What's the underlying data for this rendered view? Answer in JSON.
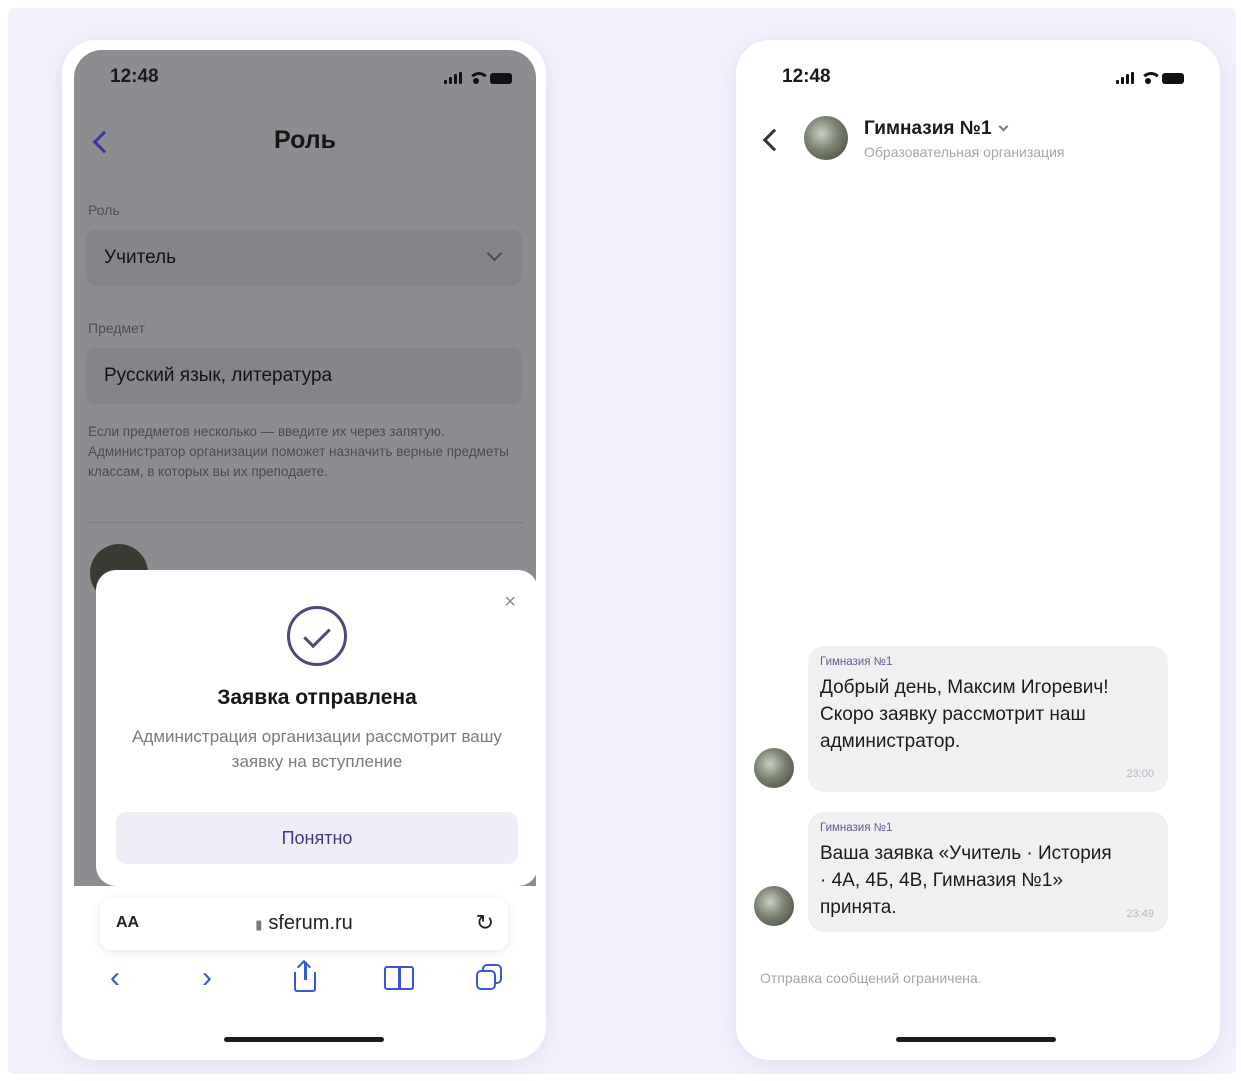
{
  "left_phone": {
    "status_time": "12:48",
    "screen_title": "Роль",
    "role_label": "Роль",
    "role_value": "Учитель",
    "subject_label": "Предмет",
    "subject_value": "Русский язык, литература",
    "hint": "Если предметов несколько — введите их через запятую. Администратор организации поможет назначить верные предметы классам, в которых вы их преподаете.",
    "modal": {
      "close": "×",
      "title": "Заявка отправлена",
      "text": "Администрация организации рассмотрит вашу заявку на вступление",
      "button": "Понятно"
    },
    "browser": {
      "text_size": "AA",
      "url": "sferum.ru",
      "reload": "↻",
      "back": "‹",
      "forward": "›"
    }
  },
  "right_phone": {
    "status_time": "12:48",
    "chat_name": "Гимназия №1",
    "chat_subtitle": "Образовательная организация",
    "messages": [
      {
        "sender": "Гимназия №1",
        "text": "Добрый день, Максим Игоревич! Скоро заявку рассмотрит наш администратор.",
        "time": "23:00"
      },
      {
        "sender": "Гимназия №1",
        "text": "Ваша заявка «Учитель · История · 4А, 4Б, 4В, Гимназия №1» принята.",
        "time": "23:49"
      }
    ],
    "restricted_note": "Отправка сообщений ограничена."
  },
  "colors": {
    "accent": "#3a57d6",
    "brand_purple": "#4c4880",
    "background": "#f1f0fb",
    "dim_overlay": "#8d8d91"
  },
  "icons": [
    "back-chevron-icon",
    "signal-icon",
    "wifi-icon",
    "battery-icon",
    "dropdown-chevron-icon",
    "check-circle-icon",
    "close-icon",
    "reload-icon",
    "share-icon",
    "bookmarks-icon",
    "tabs-icon"
  ]
}
